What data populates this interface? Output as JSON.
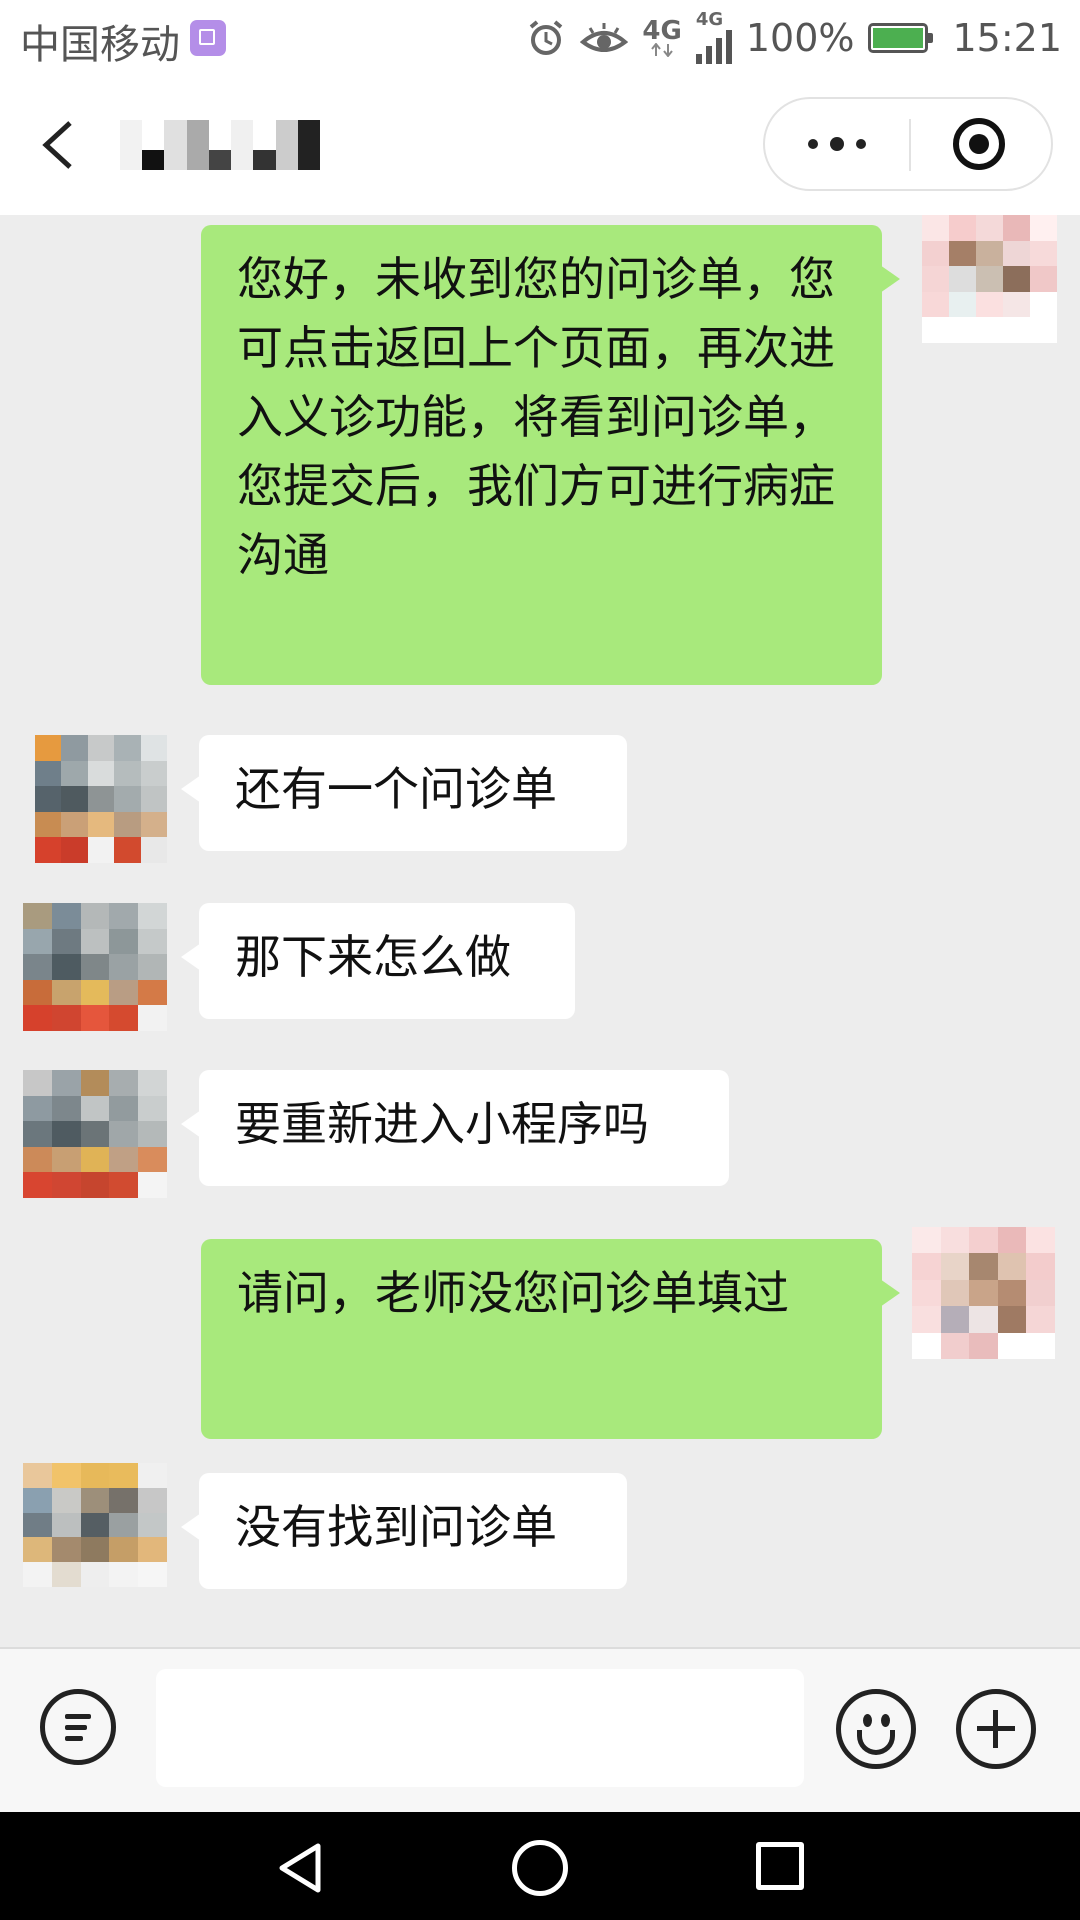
{
  "status_bar": {
    "carrier": "中国移动",
    "network_1": "4G",
    "network_2": "4G",
    "battery": "100%",
    "time": "15:21",
    "icons": [
      "sim-app-icon",
      "alarm-icon",
      "eye-icon",
      "signal-icon",
      "battery-icon"
    ]
  },
  "title_bar": {
    "back_icon": "chevron-left-icon",
    "more_icon": "more-dots-icon",
    "close_icon": "target-circle-icon"
  },
  "messages": [
    {
      "side": "out",
      "text": "您好，未收到您的问诊单，您可点击返回上个页面，再次进入义诊功能，将看到问诊单，您提交后，我们方可进行病症沟通"
    },
    {
      "side": "in",
      "text": "还有一个问诊单"
    },
    {
      "side": "in",
      "text": "那下来怎么做"
    },
    {
      "side": "in",
      "text": "要重新进入小程序吗"
    },
    {
      "side": "out",
      "text": "请问，老师没您问诊单填过"
    },
    {
      "side": "in",
      "text": "没有找到问诊单"
    }
  ],
  "input_bar": {
    "placeholder": "",
    "voice_icon": "voice-input-icon",
    "emoji_icon": "emoji-icon",
    "plus_icon": "plus-icon"
  },
  "nav_bar": {
    "icons": [
      "back-triangle-icon",
      "home-circle-icon",
      "recent-square-icon"
    ]
  },
  "colors": {
    "outgoing_bubble": "#a8e97c",
    "incoming_bubble": "#ffffff",
    "chat_background": "#ededed"
  }
}
